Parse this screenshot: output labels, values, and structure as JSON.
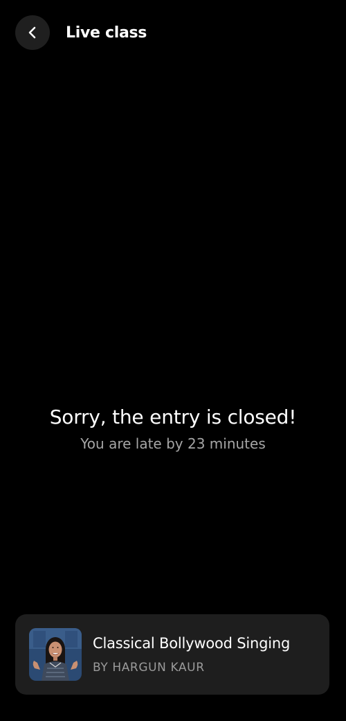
{
  "header": {
    "back_icon": "chevron-left-icon",
    "title": "Live class"
  },
  "message": {
    "title": "Sorry, the entry is closed!",
    "subtitle": "You are late by 23 minutes"
  },
  "class_card": {
    "name": "Classical Bollywood Singing",
    "instructor": "BY HARGUN KAUR",
    "thumbnail_icon": "instructor-photo"
  },
  "colors": {
    "background": "#000000",
    "card_background": "#1e1e1e",
    "back_button_background": "#1f1f1f",
    "subtitle_text": "#a6a6a6"
  }
}
